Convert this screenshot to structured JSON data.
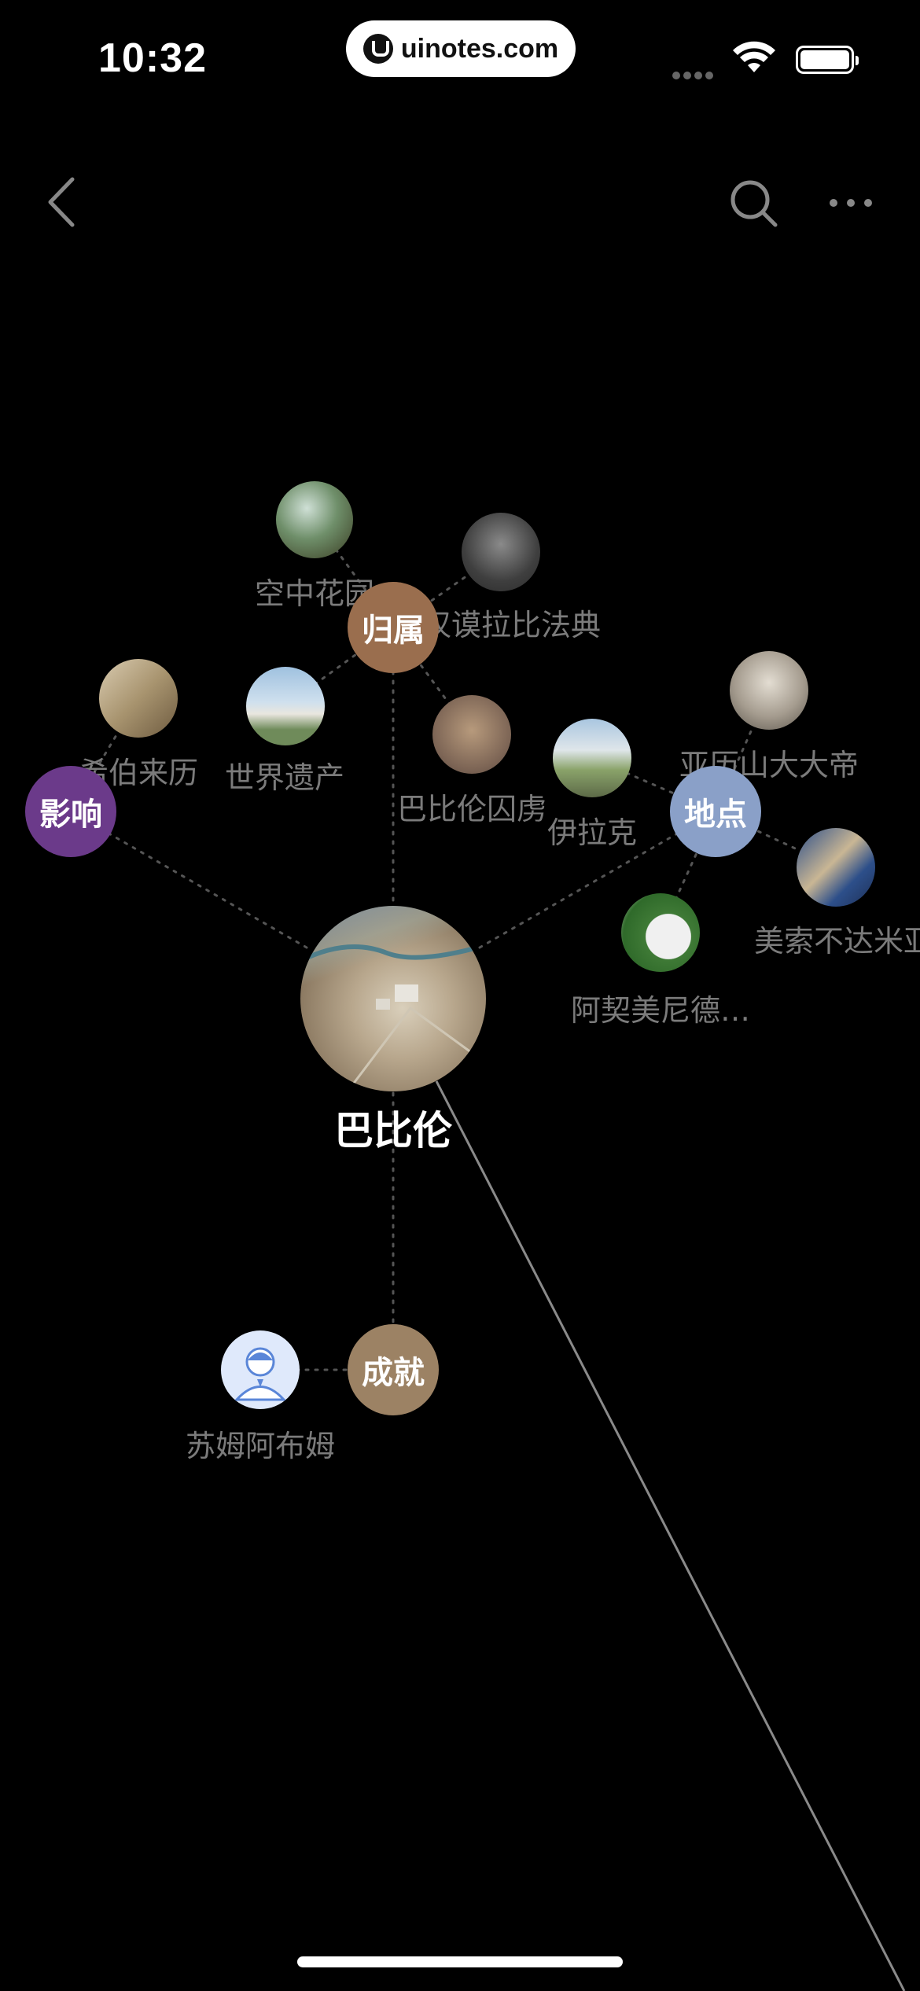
{
  "status_bar": {
    "time": "10:32",
    "url": "uinotes.com"
  },
  "nav": {
    "back_icon": "chevron-left-icon",
    "search_icon": "search-icon",
    "more_icon": "more-dots-icon"
  },
  "graph": {
    "center": {
      "label": "巴比伦"
    },
    "categories": [
      {
        "id": "belong",
        "label": "归属",
        "color": "#9a6e4e"
      },
      {
        "id": "influence",
        "label": "影响",
        "color": "#6b3a8a"
      },
      {
        "id": "location",
        "label": "地点",
        "color": "#8aa0c8"
      },
      {
        "id": "achievement",
        "label": "成就",
        "color": "#9c8264"
      }
    ],
    "items": [
      {
        "label": "空中花园"
      },
      {
        "label": "汉谟拉比法典"
      },
      {
        "label": "世界遗产"
      },
      {
        "label": "巴比伦囚虏"
      },
      {
        "label": "希伯来历"
      },
      {
        "label": "伊拉克"
      },
      {
        "label": "亚历山大大帝"
      },
      {
        "label": "美索不达米亚"
      },
      {
        "label": "阿契美尼德…"
      },
      {
        "label": "苏姆阿布姆"
      }
    ]
  }
}
